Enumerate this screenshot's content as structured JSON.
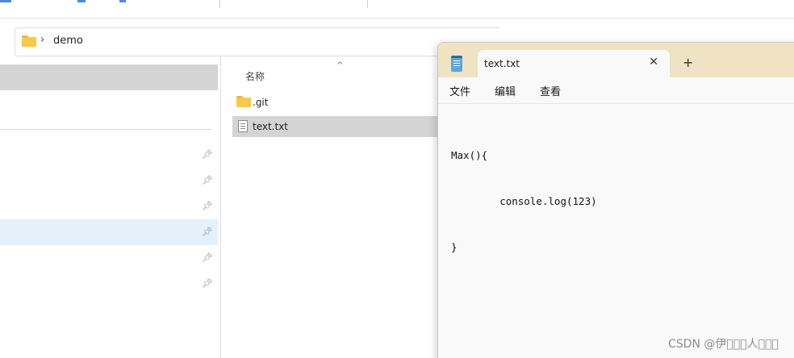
{
  "explorer": {
    "breadcrumb": [
      "demo"
    ],
    "breadcrumb_separator": "›",
    "column_header": "名称",
    "sort_indicator": "^",
    "files": [
      {
        "name": ".git",
        "type": "folder",
        "selected": false
      },
      {
        "name": "text.txt",
        "type": "text-file",
        "selected": true
      }
    ],
    "nav_pin_icon": "pin-icon"
  },
  "notepad": {
    "tab_title": "text.txt",
    "close_glyph": "✕",
    "new_tab_glyph": "+",
    "menu": [
      "文件",
      "编辑",
      "查看"
    ],
    "content_lines": [
      "Max(){",
      "        console.log(123)",
      "}"
    ],
    "titlebar_color": "#efe3c4"
  },
  "watermark": "CSDN @伊\u0000\u0000\u0000人\u0000\u0000\u0000"
}
